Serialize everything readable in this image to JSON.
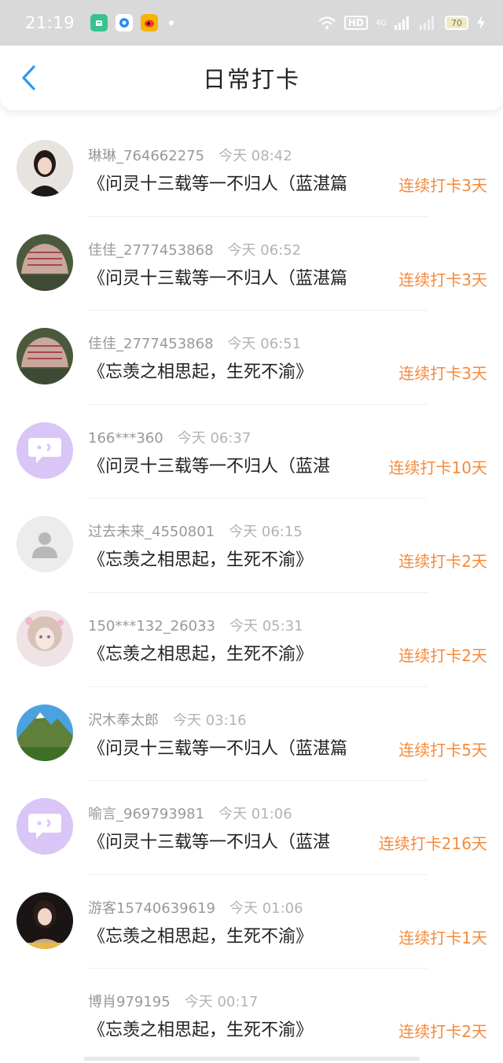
{
  "status_bar": {
    "time": "21:19",
    "network": "HD",
    "signal": "4G",
    "battery": "70",
    "icons": [
      "app-green-icon",
      "app-blue-icon",
      "weibo-icon",
      "notification-dot",
      "wifi-icon",
      "signal-icon",
      "battery-icon",
      "charging-icon"
    ]
  },
  "header": {
    "title": "日常打卡",
    "back_icon": "chevron-left-icon",
    "accent": "#2b9af3"
  },
  "items": [
    {
      "name": "琳琳_764662275",
      "time": "今天 08:42",
      "post": "《问灵十三载等一不归人（蓝湛篇",
      "streak": "连续打卡3天",
      "avatar": "photo-woman"
    },
    {
      "name": "佳佳_2777453868",
      "time": "今天 06:52",
      "post": "《问灵十三载等一不归人（蓝湛篇",
      "streak": "连续打卡3天",
      "avatar": "photo-stone"
    },
    {
      "name": "佳佳_2777453868",
      "time": "今天 06:51",
      "post": "《忘羡之相思起，生死不渝》",
      "streak": "连续打卡3天",
      "avatar": "photo-stone"
    },
    {
      "name": "166***360",
      "time": "今天 06:37",
      "post": "《问灵十三载等一不归人（蓝湛",
      "streak": "连续打卡10天",
      "avatar": "default-chat"
    },
    {
      "name": "过去未来_4550801",
      "time": "今天 06:15",
      "post": "《忘羡之相思起，生死不渝》",
      "streak": "连续打卡2天",
      "avatar": "default-person"
    },
    {
      "name": "150***132_26033",
      "time": "今天 05:31",
      "post": "《忘羡之相思起，生死不渝》",
      "streak": "连续打卡2天",
      "avatar": "photo-anime"
    },
    {
      "name": "沢木奉太郎",
      "time": "今天 03:16",
      "post": "《问灵十三载等一不归人（蓝湛篇",
      "streak": "连续打卡5天",
      "avatar": "photo-mountain"
    },
    {
      "name": "喻言_969793981",
      "time": "今天 01:06",
      "post": "《问灵十三载等一不归人（蓝湛",
      "streak": "连续打卡216天",
      "avatar": "default-chat"
    },
    {
      "name": "游客15740639619",
      "time": "今天 01:06",
      "post": "《忘羡之相思起，生死不渝》",
      "streak": "连续打卡1天",
      "avatar": "photo-woman2"
    },
    {
      "name": "博肖979195",
      "time": "今天 00:17",
      "post": "《忘羡之相思起，生死不渝》",
      "streak": "连续打卡2天",
      "avatar": "none"
    }
  ],
  "colors": {
    "streak": "#f58a3a",
    "name": "#999999",
    "text": "#222222",
    "default_avatar_purple": "#d9c6f7"
  }
}
